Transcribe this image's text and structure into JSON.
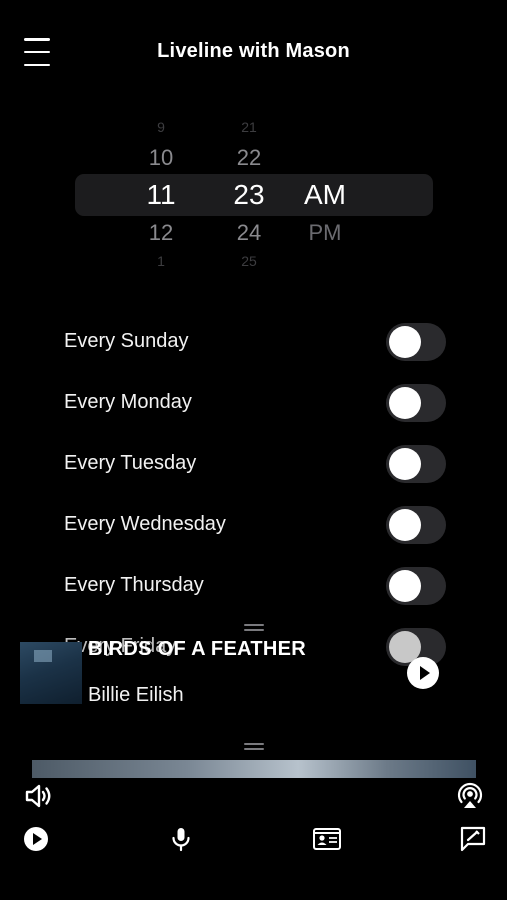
{
  "header": {
    "title": "Liveline with Mason",
    "menu_icon": "hamburger-menu-icon"
  },
  "time_picker": {
    "hours": [
      "9",
      "10",
      "11",
      "12",
      "1"
    ],
    "minutes": [
      "21",
      "22",
      "23",
      "24",
      "25"
    ],
    "periods": [
      "AM",
      "PM"
    ],
    "selected": {
      "hour": "11",
      "minute": "23",
      "period": "AM"
    }
  },
  "schedule": {
    "days": [
      {
        "label": "Every Sunday",
        "enabled": false
      },
      {
        "label": "Every Monday",
        "enabled": false
      },
      {
        "label": "Every Tuesday",
        "enabled": false
      },
      {
        "label": "Every Wednesday",
        "enabled": false
      },
      {
        "label": "Every Thursday",
        "enabled": false
      },
      {
        "label": "Every Friday",
        "enabled": false
      }
    ]
  },
  "now_playing": {
    "title": "BIRDS OF A FEATHER",
    "artist": "Billie Eilish",
    "play_icon": "play-circle-icon"
  },
  "bottom_bar": {
    "icons": [
      "volume-icon",
      "airplay-icon",
      "play-icon",
      "microphone-icon",
      "contact-card-icon",
      "compose-icon"
    ]
  },
  "colors": {
    "background": "#000000",
    "toggle_off": "#2a2a2d",
    "picker_band": "#1c1c1e"
  }
}
